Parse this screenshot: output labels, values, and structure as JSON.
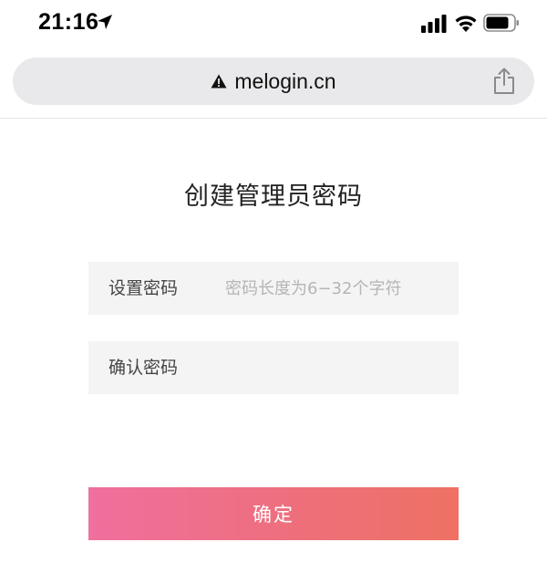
{
  "status_bar": {
    "time": "21:16"
  },
  "browser": {
    "url": "melogin.cn",
    "security_icon": "warning-triangle-icon",
    "share_icon": "share-icon"
  },
  "page": {
    "title": "创建管理员密码",
    "fields": [
      {
        "label": "设置密码",
        "value": "",
        "placeholder": "密码长度为6−32个字符"
      },
      {
        "label": "确认密码",
        "value": "",
        "placeholder": ""
      }
    ],
    "confirm_label": "确定"
  },
  "colors": {
    "button_gradient_start": "#ef6f9e",
    "button_gradient_end": "#ee7163",
    "field_background": "#f4f4f4",
    "address_bar_background": "#e9e9eb"
  }
}
